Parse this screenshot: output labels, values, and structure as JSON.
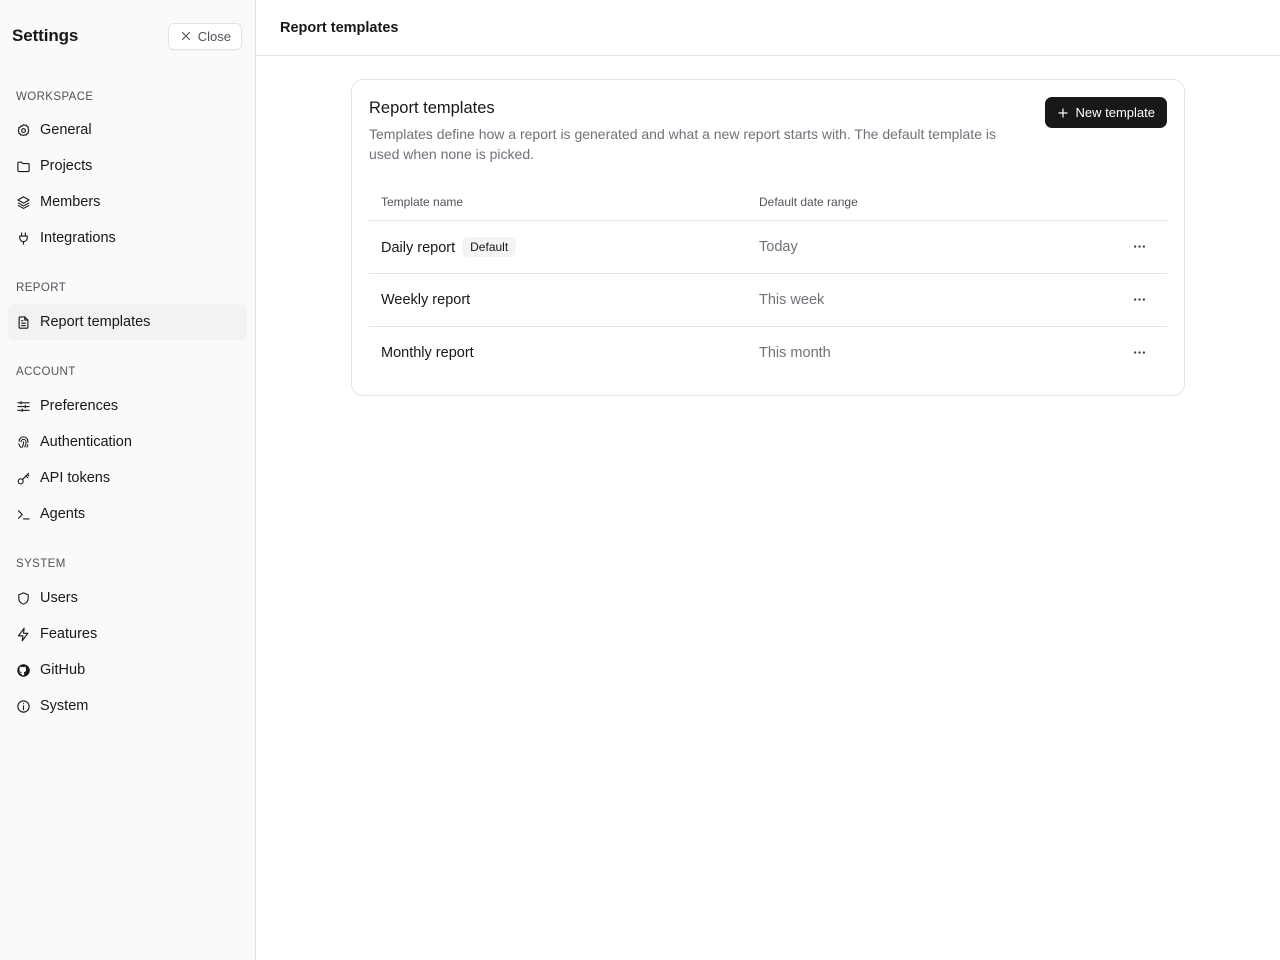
{
  "sidebar": {
    "title": "Settings",
    "close_label": "Close",
    "sections": {
      "workspace": {
        "label": "WORKSPACE",
        "items": [
          {
            "label": "General",
            "icon": "gear-icon"
          },
          {
            "label": "Projects",
            "icon": "folder-icon"
          },
          {
            "label": "Members",
            "icon": "layers-icon"
          },
          {
            "label": "Integrations",
            "icon": "plug-icon"
          }
        ]
      },
      "report": {
        "label": "REPORT",
        "items": [
          {
            "label": "Report templates",
            "icon": "document-icon",
            "active": true
          }
        ]
      },
      "account": {
        "label": "ACCOUNT",
        "items": [
          {
            "label": "Preferences",
            "icon": "sliders-icon"
          },
          {
            "label": "Authentication",
            "icon": "fingerprint-icon"
          },
          {
            "label": "API tokens",
            "icon": "key-icon"
          },
          {
            "label": "Agents",
            "icon": "terminal-icon"
          }
        ]
      },
      "system": {
        "label": "SYSTEM",
        "items": [
          {
            "label": "Users",
            "icon": "shield-icon"
          },
          {
            "label": "Features",
            "icon": "zap-icon"
          },
          {
            "label": "GitHub",
            "icon": "github-icon"
          },
          {
            "label": "System",
            "icon": "info-icon"
          }
        ]
      }
    }
  },
  "header": {
    "title": "Report templates"
  },
  "card": {
    "title": "Report templates",
    "description": "Templates define how a report is generated and what a new report starts with. The default template is used when none is picked.",
    "new_button_label": "New template"
  },
  "table": {
    "columns": [
      "Template name",
      "Default date range"
    ],
    "rows": [
      {
        "name": "Daily report",
        "badge": "Default",
        "range": "Today"
      },
      {
        "name": "Weekly report",
        "range": "This week"
      },
      {
        "name": "Monthly report",
        "range": "This month"
      }
    ]
  },
  "colors": {
    "primary": "#18181b",
    "sidebar_bg": "#fafafa",
    "border": "#e4e4e7",
    "muted_text": "#71717a"
  }
}
